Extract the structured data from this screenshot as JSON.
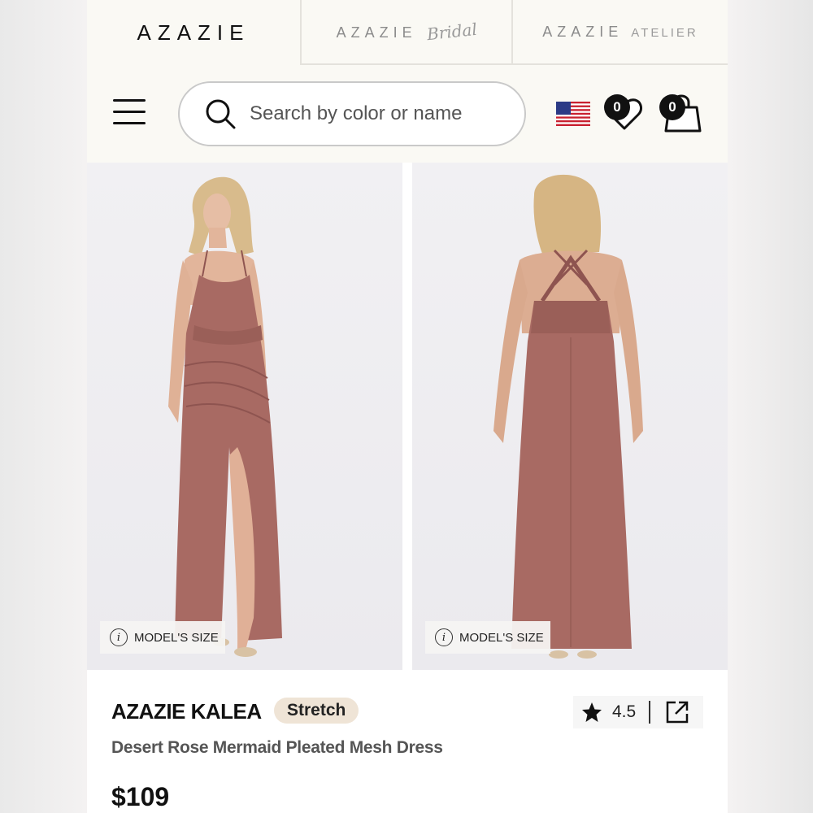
{
  "brand_tabs": {
    "main": "AZAZIE",
    "bridal_word": "AZAZIE",
    "bridal_script": "Bridal",
    "atelier_word": "AZAZIE",
    "atelier_suffix": "ATELIER"
  },
  "header": {
    "search_placeholder": "Search by color or name",
    "wishlist_count": "0",
    "cart_count": "0",
    "flag": "us-flag-icon"
  },
  "images": {
    "front_tag": "MODEL'S SIZE",
    "back_tag": "MODEL'S SIZE",
    "dress_color": "#a86a63"
  },
  "product": {
    "name": "AZAZIE KALEA",
    "badge": "Stretch",
    "rating": "4.5",
    "subtitle": "Desert Rose Mermaid Pleated Mesh Dress",
    "price": "$109"
  },
  "colors": {
    "background": "#faf9f4",
    "badge": "#efe4d6",
    "dress": "#a86a63",
    "text": "#111111"
  }
}
